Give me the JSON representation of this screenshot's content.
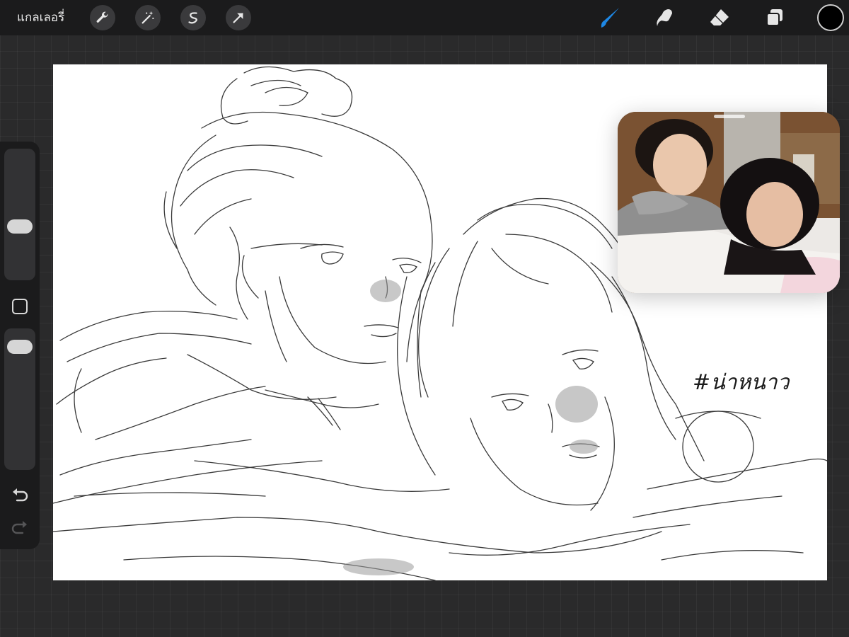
{
  "topbar": {
    "gallery_label": "แกลเลอรี่",
    "tools_left": [
      {
        "name": "actions",
        "icon": "wrench-icon"
      },
      {
        "name": "adjustments",
        "icon": "magic-wand-icon"
      },
      {
        "name": "selection",
        "icon": "selection-s-icon"
      },
      {
        "name": "transform",
        "icon": "transform-arrow-icon"
      }
    ],
    "tools_right": [
      {
        "name": "brush",
        "icon": "brush-icon",
        "active": true
      },
      {
        "name": "smudge",
        "icon": "smudge-icon",
        "active": false
      },
      {
        "name": "eraser",
        "icon": "eraser-icon",
        "active": false
      },
      {
        "name": "layers",
        "icon": "layers-icon",
        "active": false
      }
    ],
    "current_color": "#000000",
    "active_color": "#1e88e5"
  },
  "sidebar": {
    "brush_size_icon": "slider-thumb",
    "opacity_icon": "slider-thumb",
    "modify_icon": "square-icon",
    "undo_icon": "undo-icon",
    "redo_icon": "redo-icon"
  },
  "canvas": {
    "hashtag_text": "#น่าหนาว",
    "background": "#ffffff"
  },
  "reference": {
    "description_icon": "reference-photo"
  }
}
